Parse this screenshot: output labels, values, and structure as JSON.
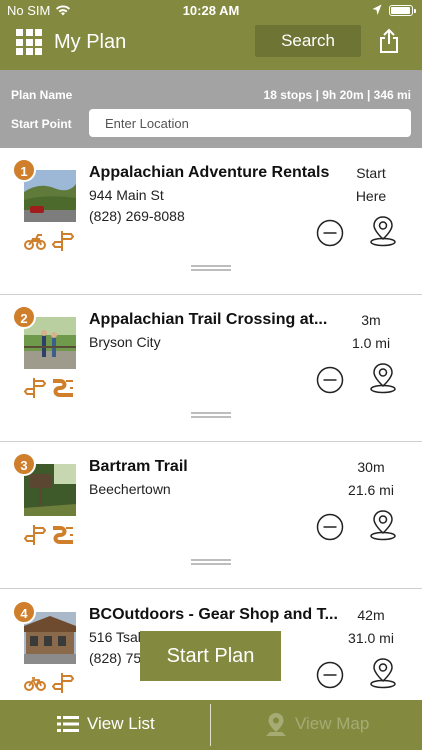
{
  "status_bar": {
    "carrier": "No SIM",
    "time": "10:28 AM"
  },
  "header": {
    "title": "My Plan",
    "search_label": "Search",
    "menu_icon": "grid-menu-icon",
    "share_icon": "share-icon"
  },
  "plan": {
    "name_label": "Plan Name",
    "stats": "18 stops | 9h 20m | 346 mi",
    "start_point_label": "Start Point",
    "start_point_placeholder": "Enter Location"
  },
  "stops": [
    {
      "number": "1",
      "name": "Appalachian Adventure Rentals",
      "line2": "944 Main St",
      "line3": "(828) 269-8088",
      "right1": "Start",
      "right2": "Here",
      "tags": [
        "motorcycle-icon",
        "signpost-icon"
      ]
    },
    {
      "number": "2",
      "name": "Appalachian Trail Crossing at...",
      "line2": "Bryson City",
      "line3": "",
      "right1": "3m",
      "right2": "1.0 mi",
      "tags": [
        "signpost-icon",
        "scenic-road-icon"
      ]
    },
    {
      "number": "3",
      "name": "Bartram Trail",
      "line2": "Beechertown",
      "line3": "",
      "right1": "30m",
      "right2": "21.6 mi",
      "tags": [
        "signpost-icon",
        "scenic-road-icon"
      ]
    },
    {
      "number": "4",
      "name": "BCOutdoors - Gear Shop and T...",
      "line2": "516 Tsal",
      "line3": "(828) 75",
      "right1": "42m",
      "right2": "31.0 mi",
      "tags": [
        "bicycle-icon",
        "signpost-icon"
      ]
    }
  ],
  "start_plan_label": "Start Plan",
  "bottom_bar": {
    "view_list_label": "View List",
    "view_map_label": "View Map"
  },
  "colors": {
    "brand_olive": "#838a3f",
    "accent_orange": "#cf7f2b",
    "panel_gray": "#a3a3a3"
  }
}
